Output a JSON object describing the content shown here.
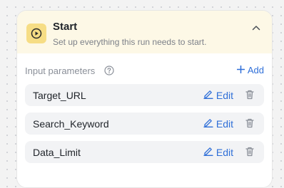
{
  "node": {
    "title": "Start",
    "subtitle": "Set up everything this run needs to start.",
    "icon": "play-circle-icon",
    "collapse_icon": "chevron-up-icon",
    "header_bg": "#fdf8e6",
    "icon_bg": "#f6dd85"
  },
  "params": {
    "label": "Input parameters",
    "help_icon": "question-circle-icon",
    "add_label": "Add",
    "add_icon": "plus-icon",
    "accent": "#2f6fd8",
    "items": [
      {
        "name": "Target_URL",
        "edit_label": "Edit"
      },
      {
        "name": "Search_Keyword",
        "edit_label": "Edit"
      },
      {
        "name": "Data_Limit",
        "edit_label": "Edit"
      }
    ]
  }
}
